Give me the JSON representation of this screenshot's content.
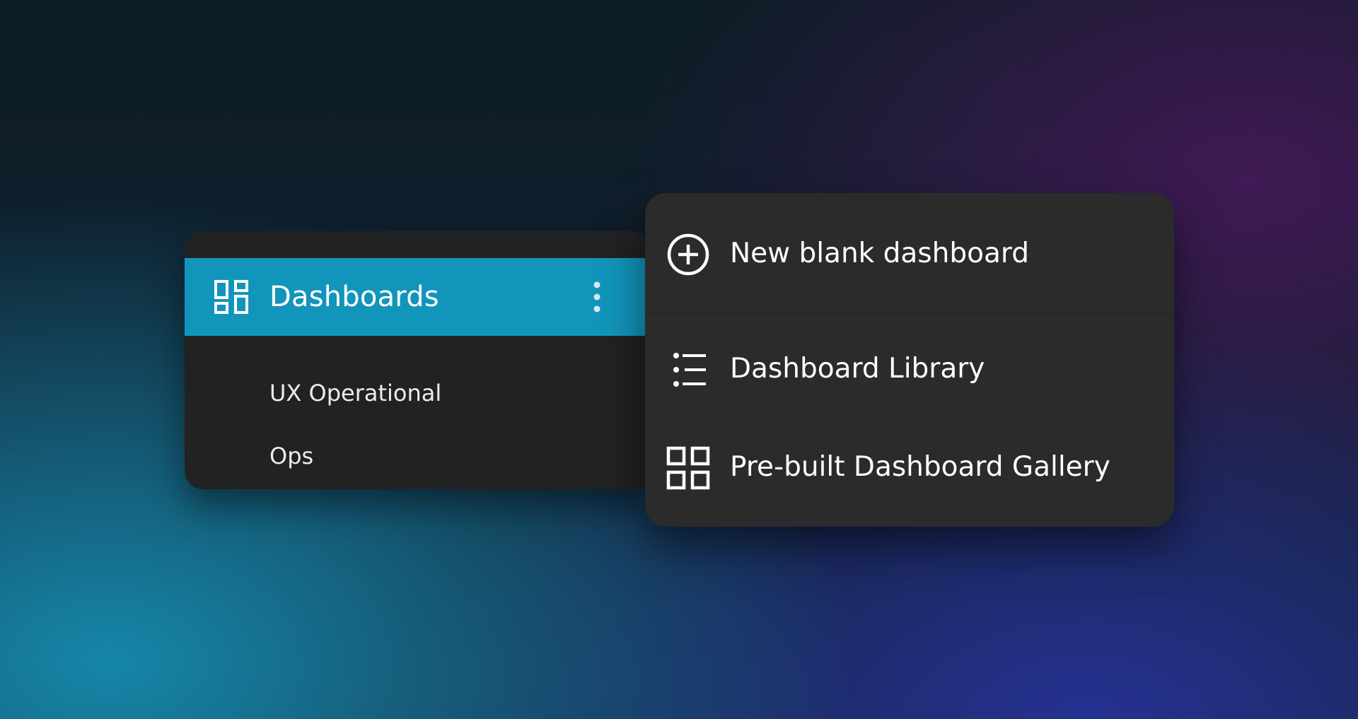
{
  "nav": {
    "header": {
      "title": "Dashboards",
      "icon": "dashboard-icon",
      "more_icon": "more-vertical-icon",
      "background_color": "#1295bb"
    },
    "items": [
      {
        "label": "UX Operational"
      },
      {
        "label": "Ops"
      }
    ]
  },
  "menu": {
    "items": [
      {
        "label": "New blank dashboard",
        "icon": "add-circle-icon"
      },
      {
        "label": "Dashboard Library",
        "icon": "list-icon"
      },
      {
        "label": "Pre-built Dashboard Gallery",
        "icon": "grid-icon"
      }
    ]
  }
}
